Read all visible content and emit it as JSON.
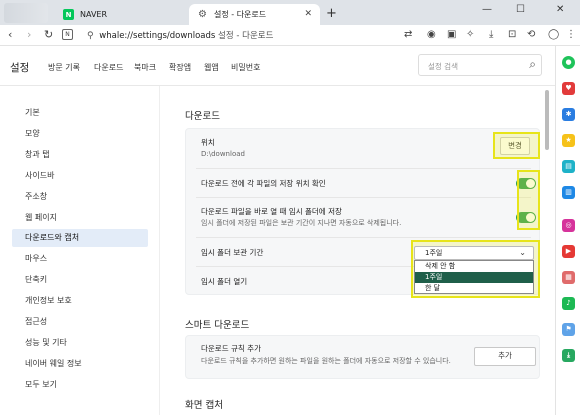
{
  "tabs": [
    {
      "label": "NAVER",
      "favicon": "naver-icon"
    },
    {
      "label": "설정 - 다운로드",
      "favicon": "gear-icon"
    }
  ],
  "address": {
    "url": "whale://settings/downloads",
    "page_title": "설정 - 다운로드"
  },
  "header": {
    "title": "설정",
    "nav": [
      "방문 기록",
      "다운로드",
      "북마크",
      "확장앱",
      "웹앱",
      "비밀번호"
    ],
    "search_placeholder": "설정 검색"
  },
  "sidebar": {
    "items": [
      {
        "label": "기본"
      },
      {
        "label": "모양"
      },
      {
        "label": "창과 탭"
      },
      {
        "label": "사이드바"
      },
      {
        "label": "주소창"
      },
      {
        "label": "웹 페이지"
      },
      {
        "label": "다운로드와 캡처",
        "active": true
      },
      {
        "label": "마우스"
      },
      {
        "label": "단축키"
      },
      {
        "label": "개인정보 보호"
      },
      {
        "label": "접근성"
      },
      {
        "label": "성능 및 기타"
      },
      {
        "label": "네이버 웨일 정보"
      },
      {
        "label": "모두 보기"
      }
    ]
  },
  "downloads": {
    "section_title": "다운로드",
    "location_label": "위치",
    "location_value": "D:\\download",
    "change_button": "변경",
    "ask_location_label": "다운로드 전에 각 파일의 저장 위치 확인",
    "open_temp_label": "다운로드 파일을 바로 열 때 임시 폴더에 저장",
    "open_temp_sub": "임시 폴더에 저장된 파일은 보관 기간이 지나면 자동으로 삭제됩니다.",
    "retention_label": "임시 폴더 보관 기간",
    "retention_selected": "1주일",
    "retention_options": [
      "삭제 안 함",
      "1주일",
      "한 달"
    ],
    "open_temp_folder_label": "임시 폴더 열기"
  },
  "smart": {
    "section_title": "스마트 다운로드",
    "rule_label": "다운로드 규칙 추가",
    "rule_sub": "다운로드 규칙을 추가하면 원하는 파일을 원하는 폴더에 자동으로 저장할 수 있습니다.",
    "add_button": "추가"
  },
  "capture": {
    "section_title": "화면 캡처"
  },
  "colors": {
    "accent": "#2f9e4f",
    "highlight": "#e7e41a",
    "active_menu": "#e3ecf8"
  }
}
